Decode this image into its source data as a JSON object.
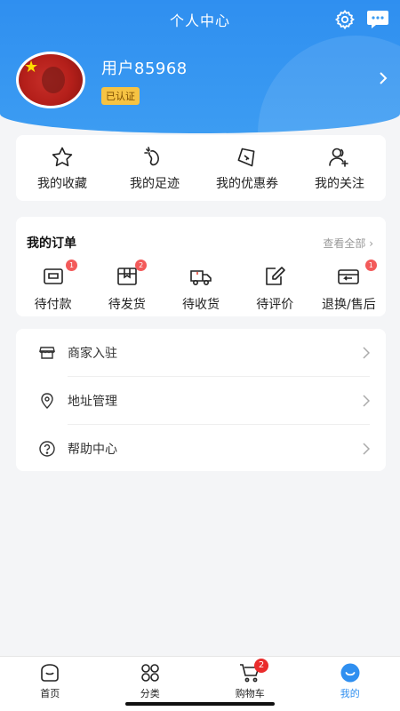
{
  "header": {
    "title": "个人中心",
    "username": "用户85968",
    "verified_badge": "已认证",
    "icons": [
      "gear-icon",
      "message-icon",
      "chevron-right-icon"
    ]
  },
  "quick_links": [
    {
      "label": "我的收藏",
      "icon": "star-icon"
    },
    {
      "label": "我的足迹",
      "icon": "footprint-icon"
    },
    {
      "label": "我的优惠券",
      "icon": "coupon-icon"
    },
    {
      "label": "我的关注",
      "icon": "follow-icon"
    }
  ],
  "orders": {
    "title": "我的订单",
    "view_all": "查看全部",
    "items": [
      {
        "label": "待付款",
        "badge": "1",
        "icon": "wallet-icon"
      },
      {
        "label": "待发货",
        "badge": "2",
        "icon": "package-icon"
      },
      {
        "label": "待收货",
        "badge": "",
        "icon": "truck-icon"
      },
      {
        "label": "待评价",
        "badge": "",
        "icon": "edit-icon"
      },
      {
        "label": "退换/售后",
        "badge": "1",
        "icon": "return-icon"
      }
    ]
  },
  "menu": [
    {
      "label": "商家入驻",
      "icon": "store-icon"
    },
    {
      "label": "地址管理",
      "icon": "location-icon"
    },
    {
      "label": "帮助中心",
      "icon": "help-icon"
    }
  ],
  "tabbar": [
    {
      "label": "首页",
      "icon": "home-icon"
    },
    {
      "label": "分类",
      "icon": "category-icon"
    },
    {
      "label": "购物车",
      "icon": "cart-icon",
      "badge": "2"
    },
    {
      "label": "我的",
      "icon": "profile-icon",
      "active": true
    }
  ],
  "colors": {
    "primary": "#2f8ff0",
    "badge_red": "#f35a5a",
    "verified_bg": "#f6c343"
  }
}
